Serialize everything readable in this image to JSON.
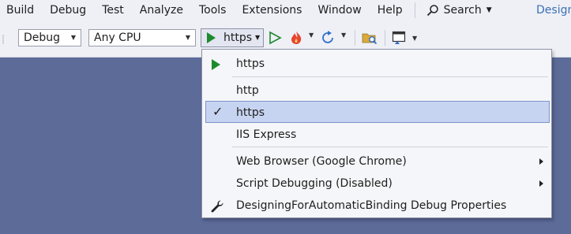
{
  "menubar": {
    "items": [
      "Build",
      "Debug",
      "Test",
      "Analyze",
      "Tools",
      "Extensions",
      "Window",
      "Help"
    ],
    "search_label": "Search",
    "window_title": "Design"
  },
  "toolbar": {
    "configuration": "Debug",
    "platform": "Any CPU",
    "launch_profile": "https"
  },
  "launch_menu": {
    "start_item": "https",
    "profiles": [
      "http",
      "https",
      "IIS Express"
    ],
    "selected_profile": "https",
    "options": [
      "Web Browser (Google Chrome)",
      "Script Debugging (Disabled)"
    ],
    "properties_item": "DesigningForAutomaticBinding Debug Properties"
  },
  "colors": {
    "accent_green": "#1e8a2e",
    "selection_bg": "#c7d4f1",
    "workspace_bg": "#5d6b99"
  }
}
